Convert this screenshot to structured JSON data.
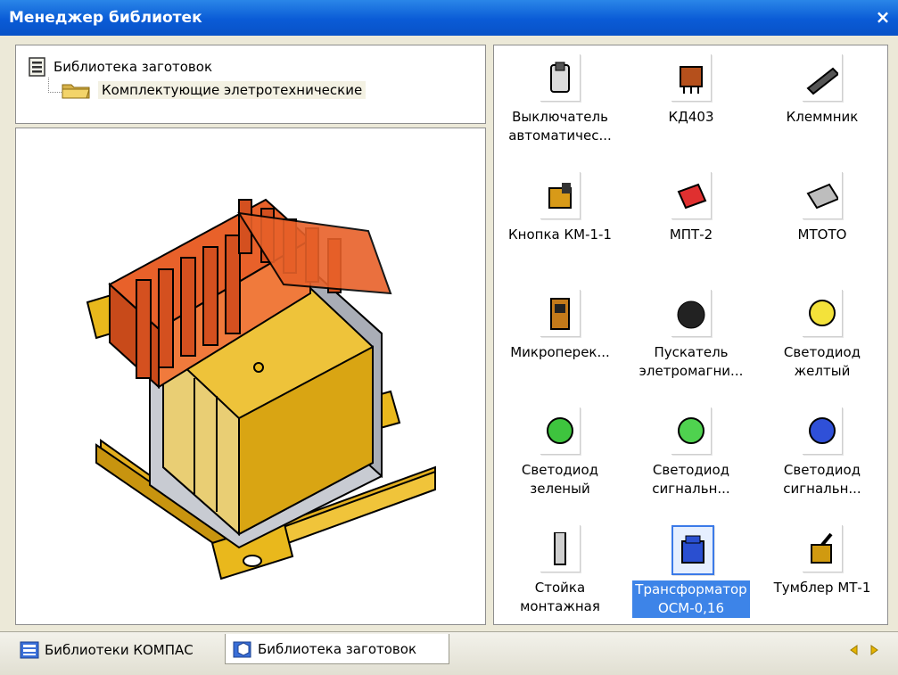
{
  "window": {
    "title": "Менеджер библиотек",
    "close_glyph": "×"
  },
  "tree": {
    "root_label": "Библиотека заготовок",
    "child_label": "Комплектующие элетротехнические"
  },
  "items": [
    {
      "caption": "Выключатель\nавтоматичес...",
      "icon": "breaker-icon"
    },
    {
      "caption": "КД403",
      "icon": "diode-icon"
    },
    {
      "caption": "Клеммник",
      "icon": "terminal-block-icon"
    },
    {
      "caption": "Кнопка КМ-1-1",
      "icon": "button-switch-icon"
    },
    {
      "caption": "МПТ-2",
      "icon": "fuse-icon"
    },
    {
      "caption": "МТОТО",
      "icon": "mtoto-icon"
    },
    {
      "caption": "Микроперек...",
      "icon": "microswitch-icon"
    },
    {
      "caption": "Пускатель\nэлетромагни...",
      "icon": "starter-icon"
    },
    {
      "caption": "Светодиод\nжелтый",
      "icon": "led-yellow-icon"
    },
    {
      "caption": "Светодиод\nзеленый",
      "icon": "led-green-icon"
    },
    {
      "caption": "Светодиод\nсигнальн...",
      "icon": "led-signal-green-icon"
    },
    {
      "caption": "Светодиод\nсигнальн...",
      "icon": "led-signal-blue-icon"
    },
    {
      "caption": "Стойка\nмонтажная",
      "icon": "standoff-icon"
    },
    {
      "caption": "Трансформатор\nОСМ-0,16",
      "icon": "transformer-icon"
    },
    {
      "caption": "Тумблер МТ-1",
      "icon": "toggle-switch-icon"
    }
  ],
  "selected_index": 13,
  "tabs": [
    {
      "label": "Библиотеки КОМПАС",
      "icon": "library-icon"
    },
    {
      "label": "Библиотека заготовок",
      "icon": "blanks-library-icon"
    }
  ],
  "colors": {
    "title_bar": "#0a5bd6",
    "selection": "#3d84e8",
    "copper": "#e8612a",
    "core": "#e9b81c"
  }
}
